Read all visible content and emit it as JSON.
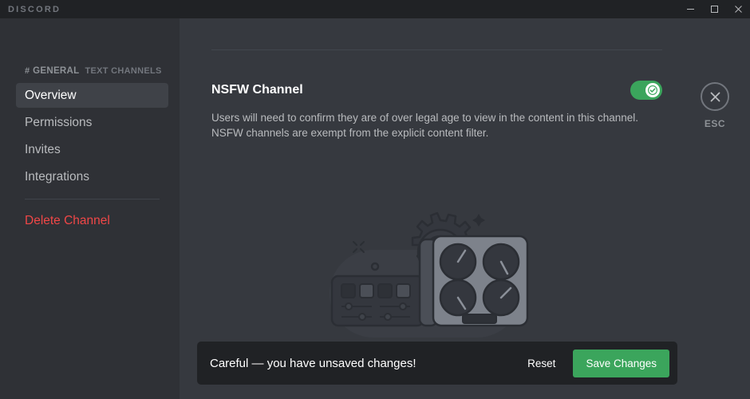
{
  "titlebar": {
    "wordmark": "DISCORD",
    "minimize_icon": "minimize-icon",
    "maximize_icon": "maximize-icon",
    "close_icon": "close-icon"
  },
  "sidebar": {
    "hash_icon": "hash-icon",
    "channel_name": "GENERAL",
    "category_label": "TEXT CHANNELS",
    "items": [
      {
        "label": "Overview",
        "active": true
      },
      {
        "label": "Permissions",
        "active": false
      },
      {
        "label": "Invites",
        "active": false
      },
      {
        "label": "Integrations",
        "active": false
      }
    ],
    "danger_item": {
      "label": "Delete Channel",
      "color": "#f04747"
    }
  },
  "main": {
    "setting": {
      "title": "NSFW Channel",
      "description": "Users will need to confirm they are of over legal age to view in the content in this channel. NSFW channels are exempt from the explicit content filter.",
      "toggle": {
        "state": "on",
        "icon": "check-icon",
        "color": "#3ba55c"
      }
    },
    "close": {
      "icon": "close-x-icon",
      "label": "ESC"
    },
    "illustration": "settings-mixer-illustration"
  },
  "savebar": {
    "message": "Careful — you have unsaved changes!",
    "reset_label": "Reset",
    "save_label": "Save Changes",
    "save_color": "#3ba55c"
  }
}
